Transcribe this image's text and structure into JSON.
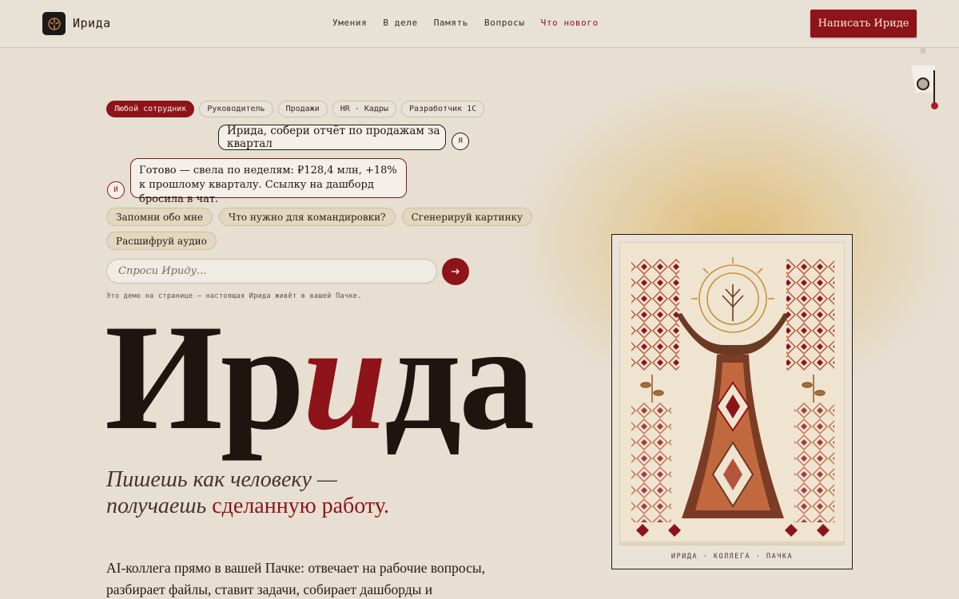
{
  "header": {
    "brand": "Ирида",
    "nav": [
      "Умения",
      "В деле",
      "Память",
      "Вопросы",
      "Что нового"
    ],
    "cta": "Написать Ириде"
  },
  "roles": [
    "Любой сотрудник",
    "Руководитель",
    "Продажи",
    "HR · Кадры",
    "Разработчик 1С"
  ],
  "chat": {
    "user_message": "Ирида, собери отчёт по продажам за квартал",
    "user_avatar": "Я",
    "bot_message": "Готово — свела по неделям: ₽128,4 млн, +18% к прошлому кварталу. Ссылку на дашборд бросила в чат.",
    "bot_avatar": "И",
    "suggestions": [
      "Запомни обо мне",
      "Что нужно для командировки?",
      "Сгенерируй картинку",
      "Расшифруй аудио"
    ],
    "input_placeholder": "Спроси Ириду...",
    "demo_note": "Это демо на странице — настоящая Ирида живёт в вашей Пачке."
  },
  "hero": {
    "title_part1": "Ир",
    "title_accent": "и",
    "title_part2": "да",
    "subtitle_lead": "Пишешь как человеку — получаешь",
    "subtitle_accent": "сделанную работу.",
    "description": "AI-коллега прямо в вашей Пачке: отвечает на рабочие вопросы, разбирает файлы, ставит задачи, собирает дашборды и"
  },
  "artwork": {
    "caption": "ИРИДА · КОЛЛЕГА · ПАЧКА"
  },
  "colors": {
    "accent": "#8e1419",
    "background": "#e6dfd2",
    "glow": "#ddb15a"
  }
}
